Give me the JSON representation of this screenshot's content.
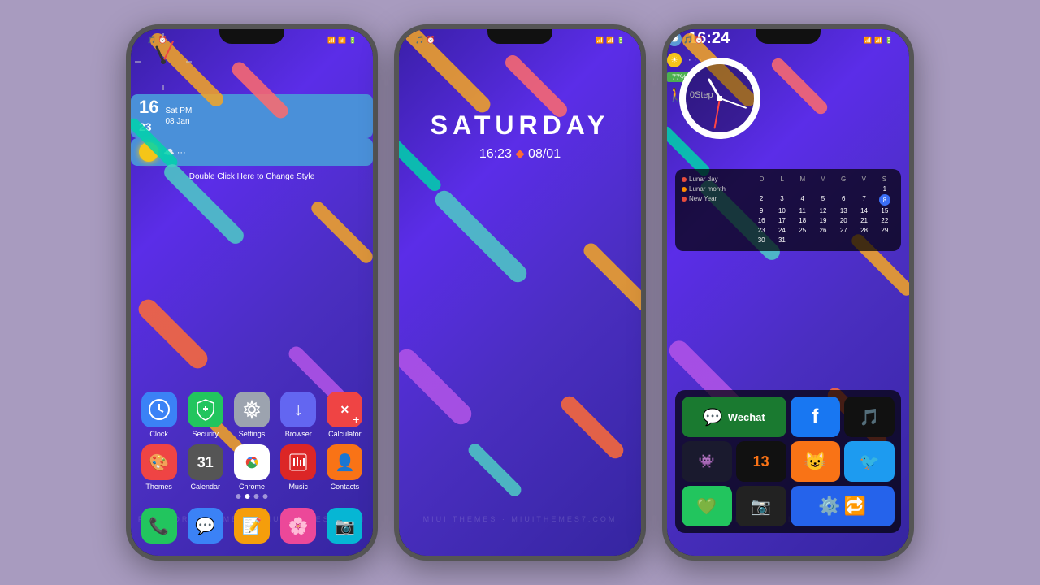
{
  "phone1": {
    "status_bar": {
      "left": "🎵 ⏰",
      "right": "📶 📶 🔋"
    },
    "clock_widget": "Clock",
    "datetime": {
      "time": "16",
      "minutes": "23",
      "day": "Sat PM",
      "date": "08 Jan"
    },
    "weather": "☁️ ···",
    "double_click": "Double Click Here to Change Style",
    "apps_row1": [
      {
        "icon": "✓",
        "label": "Clock",
        "color": "#3b82f6"
      },
      {
        "icon": "+",
        "label": "Security",
        "color": "#22c55e"
      },
      {
        "icon": "⚙",
        "label": "Settings",
        "color": "#9ca3af"
      },
      {
        "icon": "↓",
        "label": "Browser",
        "color": "#6366f1"
      },
      {
        "icon": "×",
        "label": "Calculator",
        "color": "#ef4444"
      }
    ],
    "apps_row2": [
      {
        "icon": "🎨",
        "label": "Themes",
        "color": "#ef4444"
      },
      {
        "icon": "31",
        "label": "Calendar",
        "color": "#555"
      },
      {
        "icon": "🌐",
        "label": "Chrome",
        "color": "#e5e5e5"
      },
      {
        "icon": "🎵",
        "label": "Music",
        "color": "#dc2626"
      },
      {
        "icon": "👤",
        "label": "Contacts",
        "color": "#f97316"
      }
    ],
    "bottom_apps": [
      {
        "icon": "📞",
        "color": "#22c55e"
      },
      {
        "icon": "💬",
        "color": "#3b82f6"
      },
      {
        "icon": "📝",
        "color": "#f59e0b"
      },
      {
        "icon": "🌸",
        "color": "#ec4899"
      },
      {
        "icon": "📷",
        "color": "#06b6d4"
      }
    ],
    "dots": [
      0,
      1,
      0,
      0
    ]
  },
  "phone2": {
    "day": "SATURDAY",
    "time": "16:23",
    "separator": "⬥",
    "date": "08/01",
    "watermark": "MIUI THEMES · MIUITHEMES7.COM"
  },
  "phone3": {
    "clock_time": "16:24",
    "battery": "77%",
    "steps": "0Step",
    "calendar": {
      "headers": [
        "D",
        "L",
        "M",
        "M",
        "G",
        "V",
        "S"
      ],
      "lunar_day": "Lunar day",
      "lunar_month": "Lunar month",
      "new_year": "New Year",
      "weeks": [
        [
          "",
          "",
          "",
          "",
          "",
          "",
          "1"
        ],
        [
          "2",
          "3",
          "4",
          "5",
          "6",
          "7",
          "8"
        ],
        [
          "9",
          "10",
          "11",
          "12",
          "13",
          "14",
          "15"
        ],
        [
          "16",
          "17",
          "18",
          "19",
          "20",
          "21",
          "22"
        ],
        [
          "23",
          "24",
          "25",
          "26",
          "27",
          "28",
          "29"
        ],
        [
          "30",
          "31",
          "",
          "",
          "",
          "",
          ""
        ]
      ],
      "today": "8"
    },
    "apps": [
      {
        "icon": "💬",
        "label": "Wechat",
        "color": "#1a7a30",
        "wide": true
      },
      {
        "icon": "⚙",
        "label": "",
        "color": "#2563eb"
      },
      {
        "icon": "🎵",
        "label": "",
        "color": "#111"
      },
      {
        "icon": "👾",
        "label": "",
        "color": "#1a1a2e"
      },
      {
        "icon": "13",
        "label": "",
        "color": "#111"
      },
      {
        "icon": "😺",
        "label": "",
        "color": "#f97316"
      },
      {
        "icon": "🐦",
        "label": "",
        "color": "#1d9bf0"
      },
      {
        "icon": "💚",
        "label": "",
        "color": "#22c55e"
      },
      {
        "icon": "📷",
        "label": "",
        "color": "#222"
      }
    ]
  }
}
